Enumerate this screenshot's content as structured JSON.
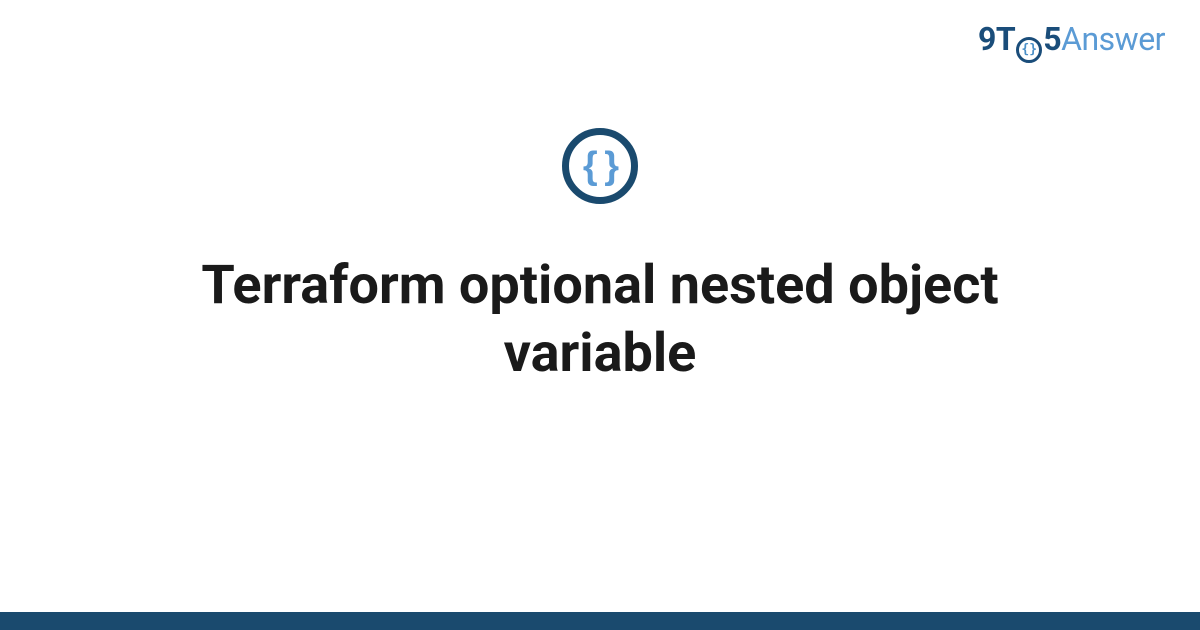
{
  "logo": {
    "part1": "9T",
    "circle_inner": "{}",
    "part2": "5",
    "part3": "Answer"
  },
  "icon": {
    "braces": "{ }"
  },
  "title": "Terraform optional nested object variable",
  "colors": {
    "brand_dark": "#1a4a6e",
    "brand_light": "#5b9bd5"
  }
}
